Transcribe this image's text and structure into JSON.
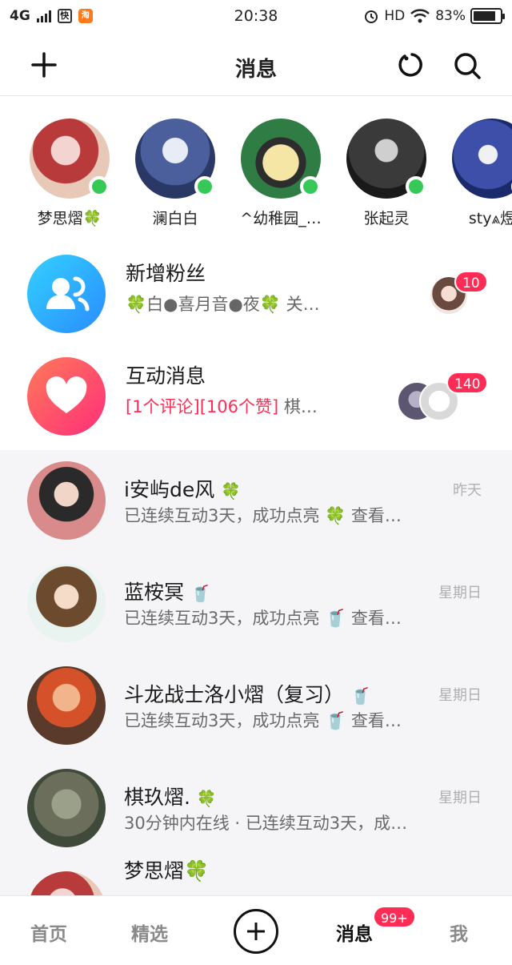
{
  "status_bar": {
    "network": "4G",
    "app_icon_1": "fast",
    "app_icon_2": "Taobao",
    "time": "20:38",
    "hd": "HD",
    "battery": "83%"
  },
  "header": {
    "title": "消息",
    "icons": [
      "plus-icon",
      "refresh-icon",
      "search-icon"
    ]
  },
  "stories": [
    {
      "name": "梦思熠🍀"
    },
    {
      "name": "澜白白"
    },
    {
      "name": "^幼稚园_…"
    },
    {
      "name": "张起灵"
    },
    {
      "name": "sty⩓煜"
    }
  ],
  "system": {
    "fans": {
      "title": "新增粉丝",
      "subtitle": "🍀白●喜月音●夜🍀 关…",
      "badge": "10"
    },
    "interact": {
      "title": "互动消息",
      "highlight": "[1个评论][106个赞]",
      "subtitle_rest": " 棋…",
      "badge": "140"
    }
  },
  "chats": [
    {
      "name": "i安屿de风",
      "emoji": "🍀",
      "message": "已连续互动3天，成功点亮 🍀 查看…",
      "time": "昨天"
    },
    {
      "name": "蓝桉冥",
      "emoji": "🥤",
      "message": "已连续互动3天，成功点亮 🥤 查看…",
      "time": "星期日"
    },
    {
      "name": "斗龙战士洛小熠（复习）",
      "emoji": "🥤",
      "message": "已连续互动3天，成功点亮 🥤 查看…",
      "time": "星期日"
    },
    {
      "name": "棋玖熠.",
      "emoji": "🍀",
      "message": "30分钟内在线 · 已连续互动3天，成…",
      "time": "星期日"
    },
    {
      "name": "梦思熠🍀",
      "emoji": "",
      "message": "",
      "time": ""
    }
  ],
  "tabbar": {
    "home": "首页",
    "featured": "精选",
    "add": "plus-circle-icon",
    "messages": "消息",
    "messages_badge": "99+",
    "me": "我"
  },
  "colors": {
    "accent_pink": "#ff2d55",
    "online_green": "#37c957",
    "fans_icon_blue": "#1fb6ff",
    "interact_icon_red": "#ff4d6d"
  }
}
